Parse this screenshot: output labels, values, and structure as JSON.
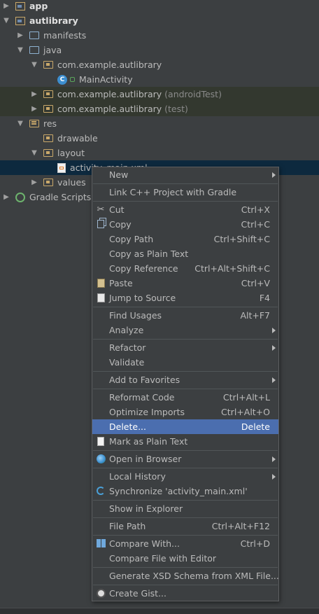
{
  "tree": [
    {
      "label": "app",
      "depth": 0,
      "arrow": "right",
      "icon": "module-folder-icon",
      "bold": true,
      "style": ""
    },
    {
      "label": "autlibrary",
      "depth": 0,
      "arrow": "down",
      "icon": "module-folder-icon",
      "bold": true,
      "style": ""
    },
    {
      "label": "manifests",
      "depth": 1,
      "arrow": "right",
      "icon": "folder-icon",
      "style": ""
    },
    {
      "label": "java",
      "depth": 1,
      "arrow": "down",
      "icon": "folder-icon",
      "style": ""
    },
    {
      "label": "com.example.autlibrary",
      "depth": 2,
      "arrow": "down",
      "icon": "package-icon",
      "style": ""
    },
    {
      "label": "MainActivity",
      "depth": 3,
      "arrow": "none",
      "icon": "class-icon",
      "style": ""
    },
    {
      "label": "com.example.autlibrary",
      "suffix": "(androidTest)",
      "depth": 2,
      "arrow": "right",
      "icon": "package-icon",
      "style": "green"
    },
    {
      "label": "com.example.autlibrary",
      "suffix": "(test)",
      "depth": 2,
      "arrow": "right",
      "icon": "package-icon",
      "style": "green"
    },
    {
      "label": "res",
      "depth": 1,
      "arrow": "down",
      "icon": "res-folder-icon",
      "style": ""
    },
    {
      "label": "drawable",
      "depth": 2,
      "arrow": "none",
      "icon": "package-icon",
      "style": ""
    },
    {
      "label": "layout",
      "depth": 2,
      "arrow": "down",
      "icon": "package-icon",
      "style": ""
    },
    {
      "label": "activity_main.xml",
      "depth": 3,
      "arrow": "none",
      "icon": "xml-file-icon",
      "style": "selected"
    },
    {
      "label": "values",
      "depth": 2,
      "arrow": "right",
      "icon": "package-icon",
      "style": ""
    },
    {
      "label": "Gradle Scripts",
      "depth": 0,
      "arrow": "right",
      "icon": "gradle-icon",
      "style": ""
    }
  ],
  "menu": [
    {
      "label": "New",
      "shortcut": "",
      "submenu": true,
      "icon": ""
    },
    {
      "sep": true
    },
    {
      "label": "Link C++ Project with Gradle",
      "shortcut": "",
      "icon": ""
    },
    {
      "sep": true
    },
    {
      "label": "Cut",
      "shortcut": "Ctrl+X",
      "icon": "scissors-icon"
    },
    {
      "label": "Copy",
      "shortcut": "Ctrl+C",
      "icon": "copy-icon"
    },
    {
      "label": "Copy Path",
      "shortcut": "Ctrl+Shift+C",
      "icon": ""
    },
    {
      "label": "Copy as Plain Text",
      "shortcut": "",
      "icon": ""
    },
    {
      "label": "Copy Reference",
      "shortcut": "Ctrl+Alt+Shift+C",
      "icon": ""
    },
    {
      "label": "Paste",
      "shortcut": "Ctrl+V",
      "icon": "paste-icon"
    },
    {
      "label": "Jump to Source",
      "shortcut": "F4",
      "icon": "jump-to-source-icon"
    },
    {
      "sep": true
    },
    {
      "label": "Find Usages",
      "shortcut": "Alt+F7",
      "icon": ""
    },
    {
      "label": "Analyze",
      "shortcut": "",
      "submenu": true,
      "icon": ""
    },
    {
      "sep": true
    },
    {
      "label": "Refactor",
      "shortcut": "",
      "submenu": true,
      "icon": ""
    },
    {
      "label": "Validate",
      "shortcut": "",
      "icon": ""
    },
    {
      "sep": true
    },
    {
      "label": "Add to Favorites",
      "shortcut": "",
      "submenu": true,
      "icon": ""
    },
    {
      "sep": true
    },
    {
      "label": "Reformat Code",
      "shortcut": "Ctrl+Alt+L",
      "icon": ""
    },
    {
      "label": "Optimize Imports",
      "shortcut": "Ctrl+Alt+O",
      "icon": ""
    },
    {
      "label": "Delete...",
      "shortcut": "Delete",
      "icon": "",
      "active": true
    },
    {
      "label": "Mark as Plain Text",
      "shortcut": "",
      "icon": "plain-text-icon"
    },
    {
      "sep": true
    },
    {
      "label": "Open in Browser",
      "shortcut": "",
      "submenu": true,
      "icon": "globe-icon"
    },
    {
      "sep": true
    },
    {
      "label": "Local History",
      "shortcut": "",
      "submenu": true,
      "icon": ""
    },
    {
      "label": "Synchronize 'activity_main.xml'",
      "shortcut": "",
      "icon": "sync-icon"
    },
    {
      "sep": true
    },
    {
      "label": "Show in Explorer",
      "shortcut": "",
      "icon": ""
    },
    {
      "sep": true
    },
    {
      "label": "File Path",
      "shortcut": "Ctrl+Alt+F12",
      "icon": ""
    },
    {
      "sep": true
    },
    {
      "label": "Compare With...",
      "shortcut": "Ctrl+D",
      "icon": "compare-icon"
    },
    {
      "label": "Compare File with Editor",
      "shortcut": "",
      "icon": ""
    },
    {
      "sep": true
    },
    {
      "label": "Generate XSD Schema from XML File...",
      "shortcut": "",
      "icon": ""
    },
    {
      "sep": true
    },
    {
      "label": "Create Gist...",
      "shortcut": "",
      "icon": "github-gist-icon"
    }
  ]
}
